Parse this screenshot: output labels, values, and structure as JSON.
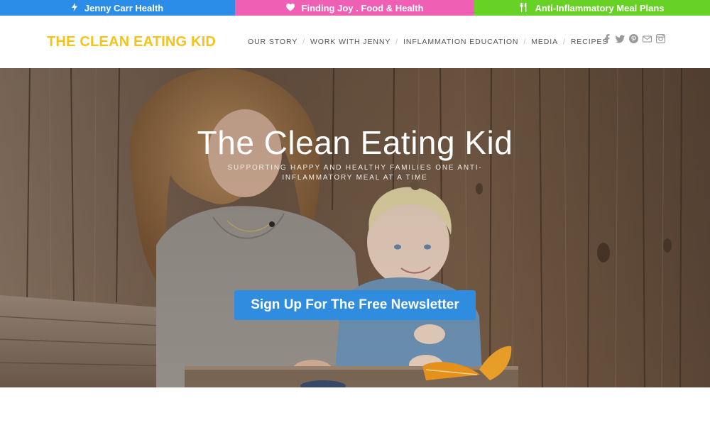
{
  "topbar": {
    "links": [
      {
        "label": "Jenny Carr Health",
        "icon": "lightning-icon",
        "color": "#2b8de8"
      },
      {
        "label": "Finding Joy . Food & Health",
        "icon": "heart-icon",
        "color": "#ef5fb4"
      },
      {
        "label": "Anti-Inflammatory Meal Plans",
        "icon": "fork-knife-icon",
        "color": "#68d125"
      }
    ]
  },
  "header": {
    "logo": "THE CLEAN EATING KID",
    "logo_color": "#f5c319",
    "nav": [
      "OUR STORY",
      "WORK WITH JENNY",
      "INFLAMMATION EDUCATION",
      "MEDIA",
      "RECIPES"
    ],
    "nav_separator": "/",
    "social": [
      "facebook-icon",
      "twitter-icon",
      "pinterest-icon",
      "mail-icon",
      "instagram-icon"
    ]
  },
  "hero": {
    "title": "The Clean Eating Kid",
    "subtitle": "SUPPORTING HAPPY AND HEALTHY FAMILIES ONE ANTI-INFLAMMATORY MEAL AT A TIME",
    "cta": "Sign Up For The Free Newsletter",
    "cta_color": "#2f8cde"
  }
}
